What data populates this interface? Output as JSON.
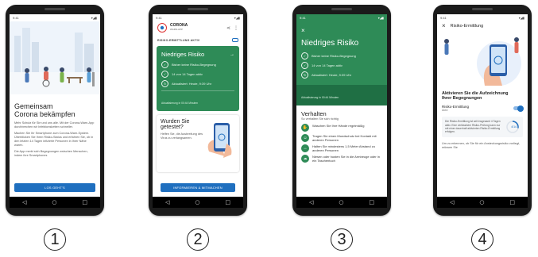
{
  "phones": [
    {
      "status_time": "9:41",
      "status_icons": "▾◢▮",
      "heading_line1": "Gemeinsam",
      "heading_line2": "Corona bekämpfen",
      "paragraph1": "Mehr Schutz für Sie und uns alle. Mit der Corona-Warn-App durchbrechen wir Infektionsketten schneller.",
      "paragraph2": "Machen Sie Ihr Smartphone zum Corona-Warn-System. Überblicken Sie Ihren Risiko-Status und erfahren Sie, ob in den letzten 14 Tagen infizierte Personen in Ihrer Nähe waren.",
      "paragraph3": "Die App merkt sich Begegnungen zwischen Menschen, indem ihre Smartphones",
      "button_label": "LOS GEHT'S",
      "step_label": "1"
    },
    {
      "status_time": "9:41",
      "status_icons": "▾◢▮",
      "logo_line1": "CORONA",
      "logo_line2": "WARN-APP",
      "section_label": "RISIKO-ERMITTLUNG AKTIV",
      "card_title": "Niedriges Risiko",
      "card_rows": [
        "Bisher keine Risiko-Begegnung",
        "14 von 14 Tagen aktiv",
        "Aktualisiert: Heute, 9:39 Uhr"
      ],
      "card_footer": "Aktualisierung in 00:44 Minuten",
      "tested_title_line1": "Wurden Sie",
      "tested_title_line2": "getestet?",
      "tested_text": "Helfen Sie, die Ausbreitung des Virus zu verlangsamen.",
      "button_label": "INFORMIEREN & MITMACHEN",
      "step_label": "2"
    },
    {
      "status_time": "9:41",
      "status_icons": "▾◢▮",
      "close_glyph": "×",
      "title": "Niedriges Risiko",
      "rows": [
        "Bisher keine Risiko-Begegnung",
        "14 von 14 Tagen aktiv",
        "Aktualisiert: Heute, 9:39 Uhr"
      ],
      "footer": "Aktualisierung in 00:44 Minuten",
      "section_title": "Verhalten",
      "section_subtitle": "So verhalten Sie sich richtig",
      "behaviors": [
        "Waschen Sie Ihre Hände regelmäßig",
        "Tragen Sie einen Mundschutz bei Kontakt mit anderen Personen",
        "Halten Sie mindestens 1,5 Meter Abstand zu anderen Personen",
        "Niesen oder husten Sie in die Armbeuge oder in ein Taschentuch"
      ],
      "step_label": "3"
    },
    {
      "status_time": "9:41",
      "status_icons": "▾◢▮",
      "close_glyph": "×",
      "screen_title": "Risiko-Ermittlung",
      "heading_line1": "Aktivieren Sie die Aufzeichnung",
      "heading_line2": "Ihrer Begegnungen",
      "toggle_label": "Risiko-Ermittlung",
      "toggle_state": "Aktiv",
      "info_text": "Die Risiko-Ermittlung ist seit insgesamt 4 Tagen aktiv. Eine verlässliche Risiko-Prüfung kann nur mit einer dauerhaft aktivierten Risiko-Ermittlung erfolgen.",
      "progress_label": "4/14",
      "bottom_text": "Um zu erkennen, ob Sie für ein Ansteckungsrisiko vorliegt, müssen Sie",
      "step_label": "4"
    }
  ],
  "nav_glyphs": {
    "back": "◁",
    "home": "○",
    "recent": "□"
  },
  "colors": {
    "green": "#2e8b57",
    "dark_green": "#1f6f44",
    "blue": "#1f6fbf"
  }
}
